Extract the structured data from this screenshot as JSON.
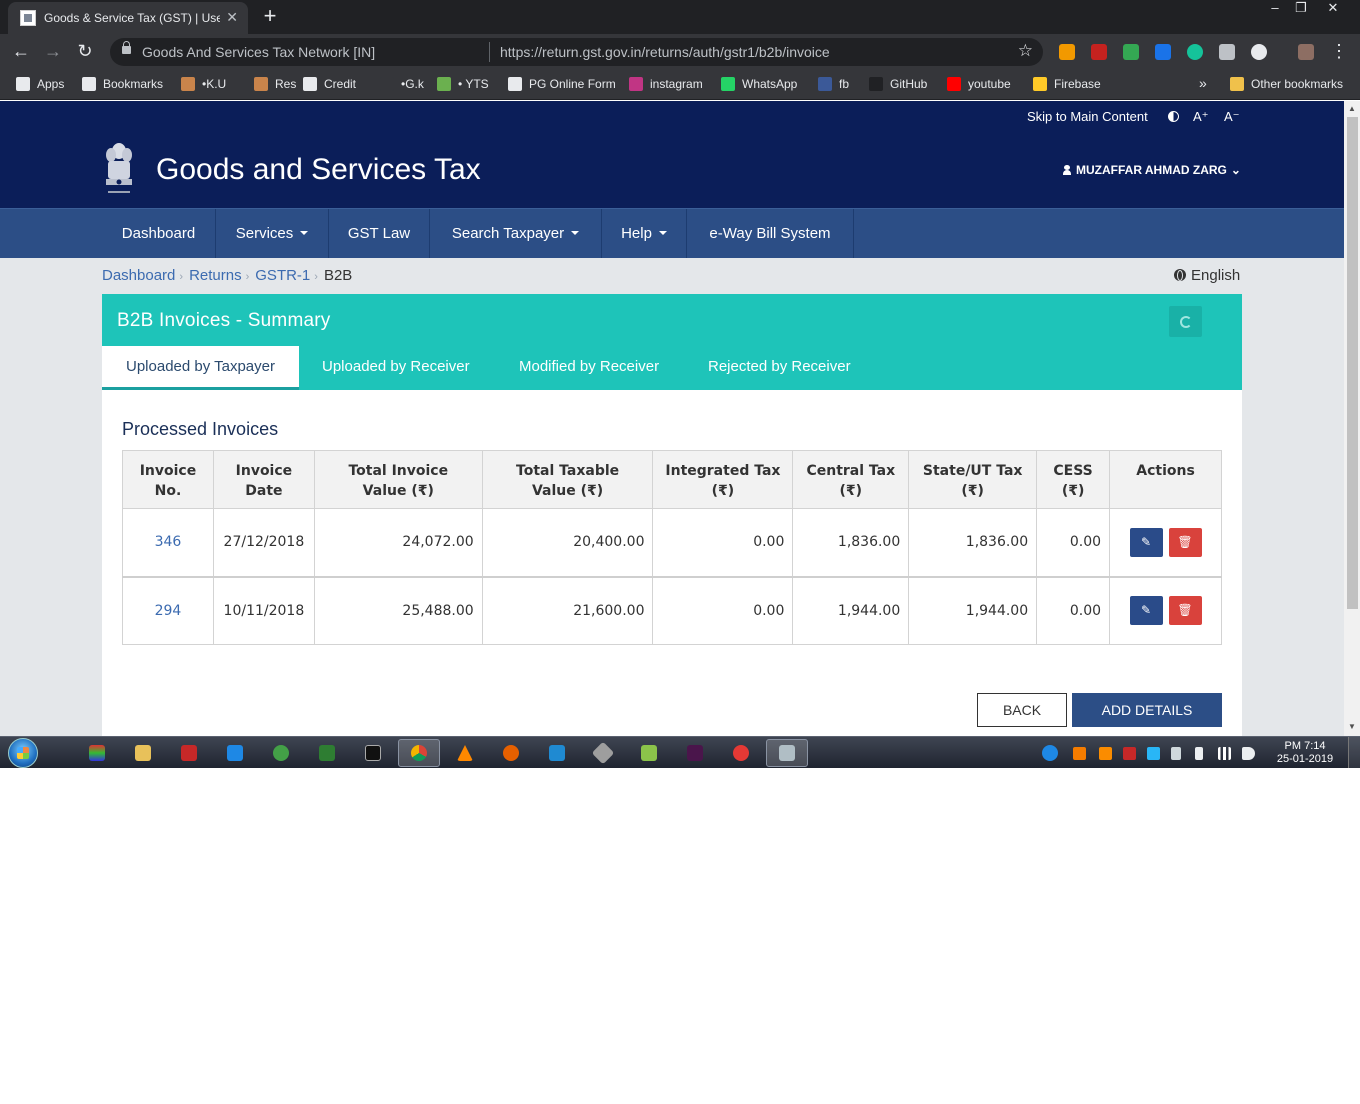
{
  "browser": {
    "tab_title": "Goods & Service Tax (GST) | User",
    "tab_close": "✕",
    "new_tab": "+",
    "site_label": "Goods And Services Tax Network [IN]",
    "url": "https://return.gst.gov.in/returns/auth/gstr1/b2b/invoice",
    "window_controls": [
      "–",
      "❐",
      "✕"
    ],
    "bookmarks": [
      {
        "label": "Apps",
        "color": "#e8eaed"
      },
      {
        "label": "Bookmarks",
        "color": "#e8eaed"
      },
      {
        "label": "•K.U",
        "color": "#c9844b"
      },
      {
        "label": "Res",
        "color": "#c9844b"
      },
      {
        "label": "Credit",
        "color": "#e8eaed"
      },
      {
        "label": "•G.k",
        "color": "#35363a"
      },
      {
        "label": "• YTS",
        "color": "#6bb04f"
      },
      {
        "label": "PG Online Form",
        "color": "#e8eaed"
      },
      {
        "label": "instagram",
        "color": "#c13584"
      },
      {
        "label": "WhatsApp",
        "color": "#25d366"
      },
      {
        "label": "fb",
        "color": "#3b5998"
      },
      {
        "label": "GitHub",
        "color": "#202124"
      },
      {
        "label": "youtube",
        "color": "#ff0000"
      },
      {
        "label": "Firebase",
        "color": "#ffca28"
      }
    ],
    "overflow": "»",
    "other_bookmarks": "Other bookmarks"
  },
  "site": {
    "skip_link": "Skip to Main Content",
    "font_increase": "A⁺",
    "font_decrease": "A⁻",
    "brand": "Goods and Services Tax",
    "user": "MUZAFFAR AHMAD ZARG",
    "nav": [
      "Dashboard",
      "Services",
      "GST Law",
      "Search Taxpayer",
      "Help",
      "e-Way Bill System"
    ],
    "breadcrumb": [
      "Dashboard",
      "Returns",
      "GSTR-1",
      "B2B"
    ],
    "language": "English"
  },
  "panel": {
    "title": "B2B Invoices - Summary",
    "tabs": [
      "Uploaded by Taxpayer",
      "Uploaded by Receiver",
      "Modified by Receiver",
      "Rejected by Receiver"
    ],
    "section_title": "Processed Invoices",
    "columns": [
      [
        "Invoice",
        "No."
      ],
      [
        "Invoice",
        "Date"
      ],
      [
        "Total Invoice",
        "Value (₹)"
      ],
      [
        "Total Taxable",
        "Value (₹)"
      ],
      [
        "Integrated Tax",
        "(₹)"
      ],
      [
        "Central Tax",
        "(₹)"
      ],
      [
        "State/UT Tax",
        "(₹)"
      ],
      [
        "CESS",
        "(₹)"
      ],
      [
        "Actions"
      ]
    ],
    "rows": [
      {
        "invoice_no": "346",
        "date": "27/12/2018",
        "invoice_value": "24,072.00",
        "taxable_value": "20,400.00",
        "igst": "0.00",
        "cgst": "1,836.00",
        "sgst": "1,836.00",
        "cess": "0.00"
      },
      {
        "invoice_no": "294",
        "date": "10/11/2018",
        "invoice_value": "25,488.00",
        "taxable_value": "21,600.00",
        "igst": "0.00",
        "cgst": "1,944.00",
        "sgst": "1,944.00",
        "cess": "0.00"
      }
    ],
    "back_button": "BACK",
    "add_button": "ADD DETAILS"
  },
  "taskbar": {
    "time": "PM 7:14",
    "date": "25-01-2019"
  },
  "colors": {
    "header_navy": "#0b1e59",
    "nav_blue": "#2c4e86",
    "panel_teal": "#1ec4b9",
    "link_blue": "#3c6bb0",
    "delete_red": "#d9423c"
  }
}
